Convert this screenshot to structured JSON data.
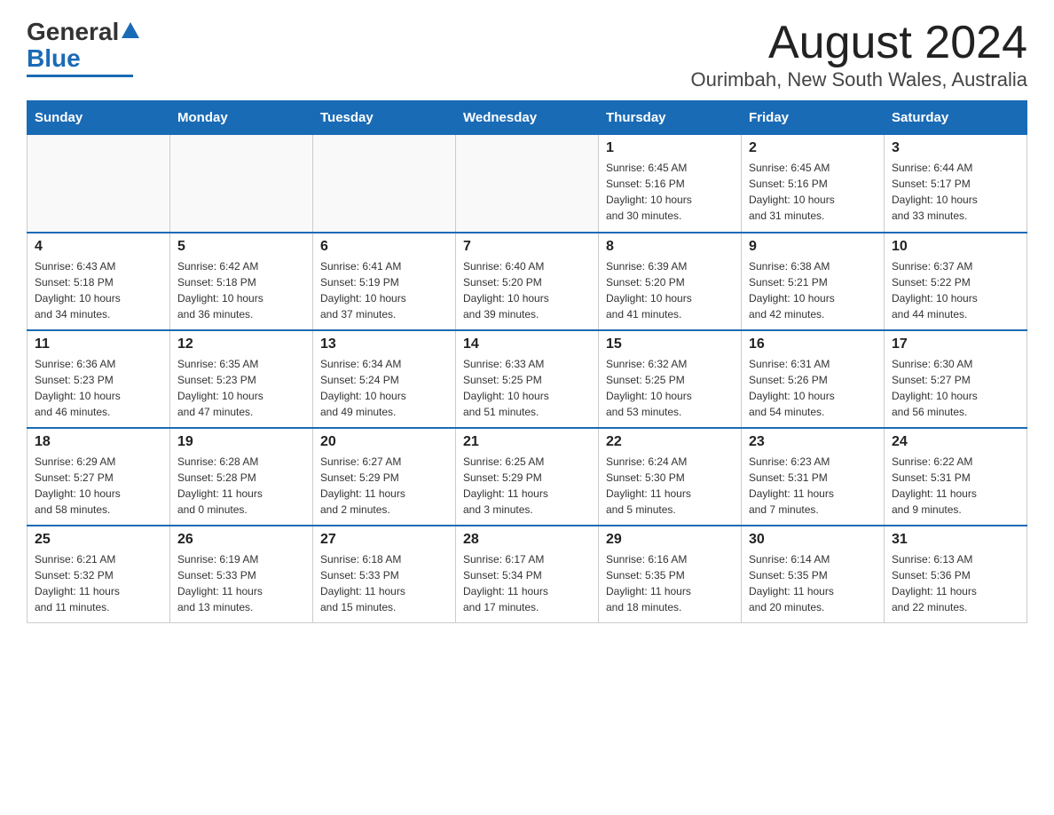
{
  "logo": {
    "general": "General",
    "blue": "Blue"
  },
  "title": {
    "month_year": "August 2024",
    "location": "Ourimbah, New South Wales, Australia"
  },
  "headers": [
    "Sunday",
    "Monday",
    "Tuesday",
    "Wednesday",
    "Thursday",
    "Friday",
    "Saturday"
  ],
  "weeks": [
    [
      {
        "day": "",
        "info": ""
      },
      {
        "day": "",
        "info": ""
      },
      {
        "day": "",
        "info": ""
      },
      {
        "day": "",
        "info": ""
      },
      {
        "day": "1",
        "info": "Sunrise: 6:45 AM\nSunset: 5:16 PM\nDaylight: 10 hours\nand 30 minutes."
      },
      {
        "day": "2",
        "info": "Sunrise: 6:45 AM\nSunset: 5:16 PM\nDaylight: 10 hours\nand 31 minutes."
      },
      {
        "day": "3",
        "info": "Sunrise: 6:44 AM\nSunset: 5:17 PM\nDaylight: 10 hours\nand 33 minutes."
      }
    ],
    [
      {
        "day": "4",
        "info": "Sunrise: 6:43 AM\nSunset: 5:18 PM\nDaylight: 10 hours\nand 34 minutes."
      },
      {
        "day": "5",
        "info": "Sunrise: 6:42 AM\nSunset: 5:18 PM\nDaylight: 10 hours\nand 36 minutes."
      },
      {
        "day": "6",
        "info": "Sunrise: 6:41 AM\nSunset: 5:19 PM\nDaylight: 10 hours\nand 37 minutes."
      },
      {
        "day": "7",
        "info": "Sunrise: 6:40 AM\nSunset: 5:20 PM\nDaylight: 10 hours\nand 39 minutes."
      },
      {
        "day": "8",
        "info": "Sunrise: 6:39 AM\nSunset: 5:20 PM\nDaylight: 10 hours\nand 41 minutes."
      },
      {
        "day": "9",
        "info": "Sunrise: 6:38 AM\nSunset: 5:21 PM\nDaylight: 10 hours\nand 42 minutes."
      },
      {
        "day": "10",
        "info": "Sunrise: 6:37 AM\nSunset: 5:22 PM\nDaylight: 10 hours\nand 44 minutes."
      }
    ],
    [
      {
        "day": "11",
        "info": "Sunrise: 6:36 AM\nSunset: 5:23 PM\nDaylight: 10 hours\nand 46 minutes."
      },
      {
        "day": "12",
        "info": "Sunrise: 6:35 AM\nSunset: 5:23 PM\nDaylight: 10 hours\nand 47 minutes."
      },
      {
        "day": "13",
        "info": "Sunrise: 6:34 AM\nSunset: 5:24 PM\nDaylight: 10 hours\nand 49 minutes."
      },
      {
        "day": "14",
        "info": "Sunrise: 6:33 AM\nSunset: 5:25 PM\nDaylight: 10 hours\nand 51 minutes."
      },
      {
        "day": "15",
        "info": "Sunrise: 6:32 AM\nSunset: 5:25 PM\nDaylight: 10 hours\nand 53 minutes."
      },
      {
        "day": "16",
        "info": "Sunrise: 6:31 AM\nSunset: 5:26 PM\nDaylight: 10 hours\nand 54 minutes."
      },
      {
        "day": "17",
        "info": "Sunrise: 6:30 AM\nSunset: 5:27 PM\nDaylight: 10 hours\nand 56 minutes."
      }
    ],
    [
      {
        "day": "18",
        "info": "Sunrise: 6:29 AM\nSunset: 5:27 PM\nDaylight: 10 hours\nand 58 minutes."
      },
      {
        "day": "19",
        "info": "Sunrise: 6:28 AM\nSunset: 5:28 PM\nDaylight: 11 hours\nand 0 minutes."
      },
      {
        "day": "20",
        "info": "Sunrise: 6:27 AM\nSunset: 5:29 PM\nDaylight: 11 hours\nand 2 minutes."
      },
      {
        "day": "21",
        "info": "Sunrise: 6:25 AM\nSunset: 5:29 PM\nDaylight: 11 hours\nand 3 minutes."
      },
      {
        "day": "22",
        "info": "Sunrise: 6:24 AM\nSunset: 5:30 PM\nDaylight: 11 hours\nand 5 minutes."
      },
      {
        "day": "23",
        "info": "Sunrise: 6:23 AM\nSunset: 5:31 PM\nDaylight: 11 hours\nand 7 minutes."
      },
      {
        "day": "24",
        "info": "Sunrise: 6:22 AM\nSunset: 5:31 PM\nDaylight: 11 hours\nand 9 minutes."
      }
    ],
    [
      {
        "day": "25",
        "info": "Sunrise: 6:21 AM\nSunset: 5:32 PM\nDaylight: 11 hours\nand 11 minutes."
      },
      {
        "day": "26",
        "info": "Sunrise: 6:19 AM\nSunset: 5:33 PM\nDaylight: 11 hours\nand 13 minutes."
      },
      {
        "day": "27",
        "info": "Sunrise: 6:18 AM\nSunset: 5:33 PM\nDaylight: 11 hours\nand 15 minutes."
      },
      {
        "day": "28",
        "info": "Sunrise: 6:17 AM\nSunset: 5:34 PM\nDaylight: 11 hours\nand 17 minutes."
      },
      {
        "day": "29",
        "info": "Sunrise: 6:16 AM\nSunset: 5:35 PM\nDaylight: 11 hours\nand 18 minutes."
      },
      {
        "day": "30",
        "info": "Sunrise: 6:14 AM\nSunset: 5:35 PM\nDaylight: 11 hours\nand 20 minutes."
      },
      {
        "day": "31",
        "info": "Sunrise: 6:13 AM\nSunset: 5:36 PM\nDaylight: 11 hours\nand 22 minutes."
      }
    ]
  ]
}
